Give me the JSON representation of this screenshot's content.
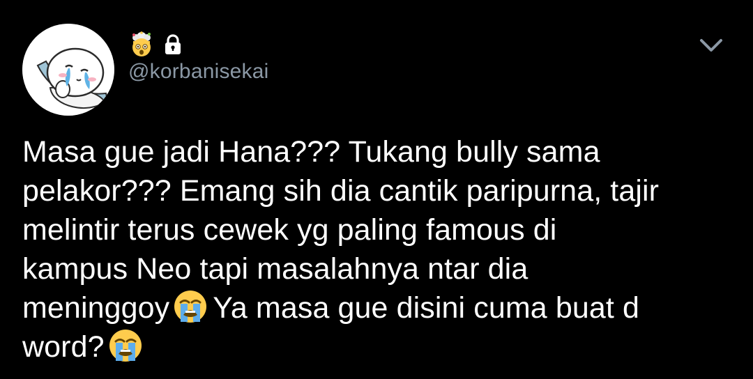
{
  "user": {
    "handle": "@korbanisekai",
    "name_emoji": "exploding-head-emoji",
    "protected_icon": "lock-icon",
    "avatar": "cartoon-character-avatar"
  },
  "menu": {
    "icon": "chevron-down-icon"
  },
  "tweet": {
    "line1": "Masa gue jadi Hana??? Tukang bully sama",
    "line2": "pelakor??? Emang sih dia cantik paripurna, tajir",
    "line3": "melintir terus cewek yg paling famous di",
    "line4": "kampus Neo tapi masalahnya ntar dia",
    "line5a": "meninggoy",
    "line5b": "Ya masa gue disini cuma buat d",
    "line6": "word?",
    "emoji": "loudly-crying-face-emoji"
  },
  "colors": {
    "background": "#000000",
    "text": "#ffffff",
    "secondary": "#8b98a5"
  }
}
